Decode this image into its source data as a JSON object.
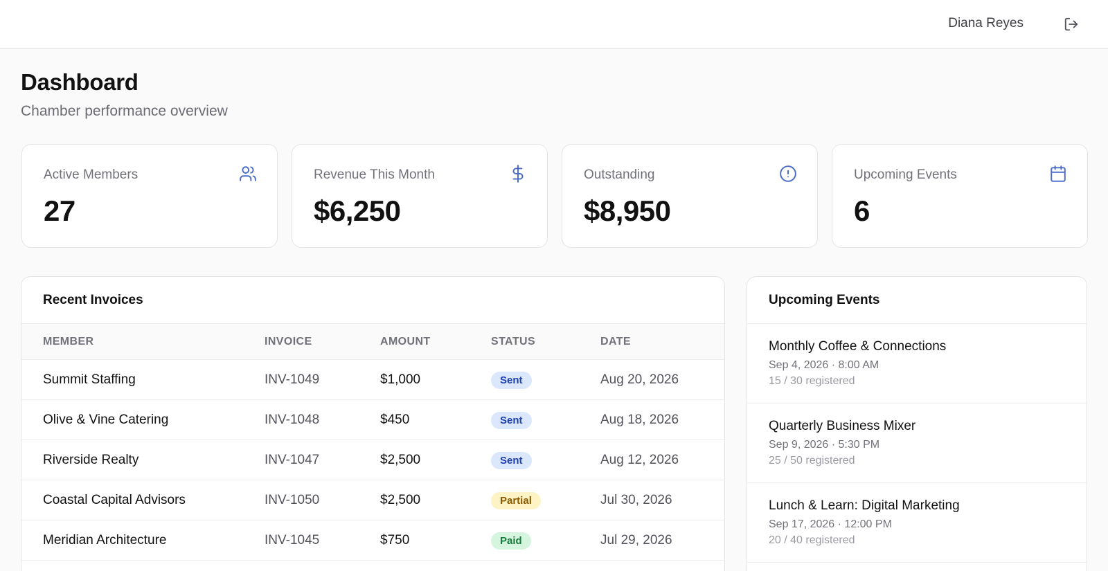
{
  "header": {
    "user_name": "Diana Reyes"
  },
  "page": {
    "title": "Dashboard",
    "subtitle": "Chamber performance overview"
  },
  "stats": [
    {
      "label": "Active Members",
      "value": "27",
      "icon": "users-icon"
    },
    {
      "label": "Revenue This Month",
      "value": "$6,250",
      "icon": "dollar-icon"
    },
    {
      "label": "Outstanding",
      "value": "$8,950",
      "icon": "alert-circle-icon"
    },
    {
      "label": "Upcoming Events",
      "value": "6",
      "icon": "calendar-icon"
    }
  ],
  "invoices": {
    "title": "Recent Invoices",
    "columns": [
      "MEMBER",
      "INVOICE",
      "AMOUNT",
      "STATUS",
      "DATE"
    ],
    "rows": [
      {
        "member": "Summit Staffing",
        "invoice": "INV-1049",
        "amount": "$1,000",
        "status": "Sent",
        "date": "Aug 20, 2026"
      },
      {
        "member": "Olive & Vine Catering",
        "invoice": "INV-1048",
        "amount": "$450",
        "status": "Sent",
        "date": "Aug 18, 2026"
      },
      {
        "member": "Riverside Realty",
        "invoice": "INV-1047",
        "amount": "$2,500",
        "status": "Sent",
        "date": "Aug 12, 2026"
      },
      {
        "member": "Coastal Capital Advisors",
        "invoice": "INV-1050",
        "amount": "$2,500",
        "status": "Partial",
        "date": "Jul 30, 2026"
      },
      {
        "member": "Meridian Architecture",
        "invoice": "INV-1045",
        "amount": "$750",
        "status": "Paid",
        "date": "Jul 29, 2026"
      }
    ]
  },
  "events": {
    "title": "Upcoming Events",
    "items": [
      {
        "name": "Monthly Coffee & Connections",
        "when": "Sep 4, 2026 · 8:00 AM",
        "registered": "15 / 30 registered"
      },
      {
        "name": "Quarterly Business Mixer",
        "when": "Sep 9, 2026 · 5:30 PM",
        "registered": "25 / 50 registered"
      },
      {
        "name": "Lunch & Learn: Digital Marketing",
        "when": "Sep 17, 2026 · 12:00 PM",
        "registered": "20 / 40 registered"
      }
    ]
  },
  "colors": {
    "accent": "#4a6cc7",
    "badge_sent_bg": "#dbe7fd",
    "badge_sent_fg": "#1e40af",
    "badge_partial_bg": "#fdf3c4",
    "badge_partial_fg": "#8a5a00",
    "badge_paid_bg": "#d6f5df",
    "badge_paid_fg": "#167a3c"
  }
}
